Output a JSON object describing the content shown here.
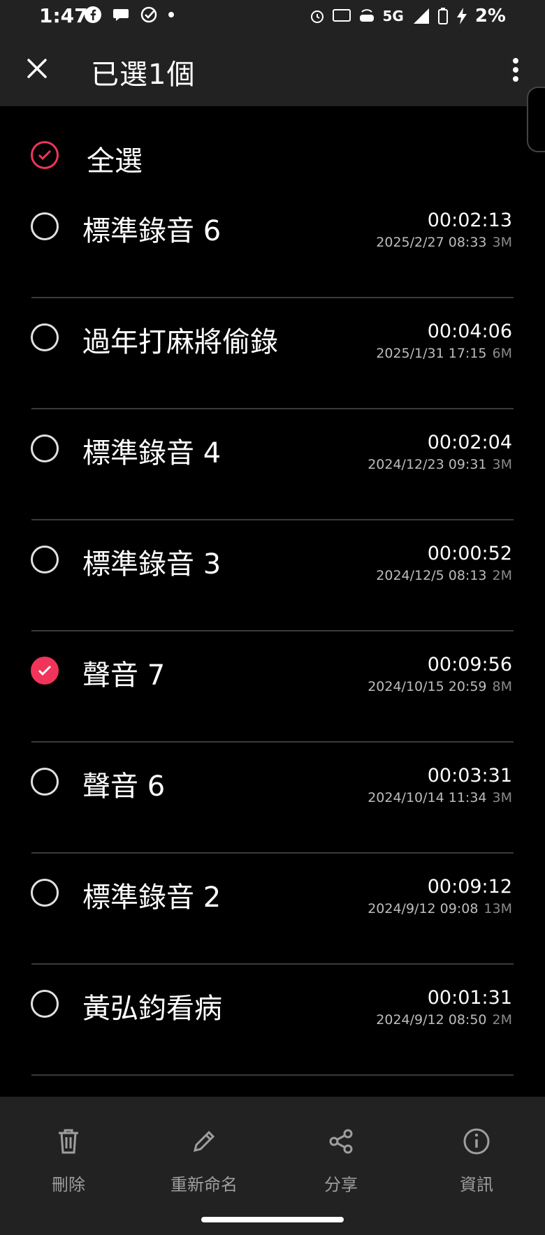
{
  "status": {
    "time": "1:47",
    "battery": "2%",
    "network": "5G"
  },
  "appbar": {
    "title": "已選1個"
  },
  "select_all": {
    "label": "全選"
  },
  "recordings": [
    {
      "title": "標準錄音 6",
      "duration": "00:02:13",
      "date": "2025/2/27 08:33",
      "size": "3M",
      "checked": false
    },
    {
      "title": "過年打麻將偷錄",
      "duration": "00:04:06",
      "date": "2025/1/31 17:15",
      "size": "6M",
      "checked": false
    },
    {
      "title": "標準錄音 4",
      "duration": "00:02:04",
      "date": "2024/12/23 09:31",
      "size": "3M",
      "checked": false
    },
    {
      "title": "標準錄音 3",
      "duration": "00:00:52",
      "date": "2024/12/5 08:13",
      "size": "2M",
      "checked": false
    },
    {
      "title": "聲音 7",
      "duration": "00:09:56",
      "date": "2024/10/15 20:59",
      "size": "8M",
      "checked": true
    },
    {
      "title": "聲音 6",
      "duration": "00:03:31",
      "date": "2024/10/14 11:34",
      "size": "3M",
      "checked": false
    },
    {
      "title": "標準錄音 2",
      "duration": "00:09:12",
      "date": "2024/9/12 09:08",
      "size": "13M",
      "checked": false
    },
    {
      "title": "黃弘鈞看病",
      "duration": "00:01:31",
      "date": "2024/9/12 08:50",
      "size": "2M",
      "checked": false
    }
  ],
  "bottom_actions": [
    {
      "label": "刪除",
      "icon": "trash-icon"
    },
    {
      "label": "重新命名",
      "icon": "pencil-icon"
    },
    {
      "label": "分享",
      "icon": "share-icon"
    },
    {
      "label": "資訊",
      "icon": "info-icon"
    }
  ],
  "colors": {
    "accent": "#f0345a",
    "bar": "#222222",
    "background": "#000000"
  }
}
